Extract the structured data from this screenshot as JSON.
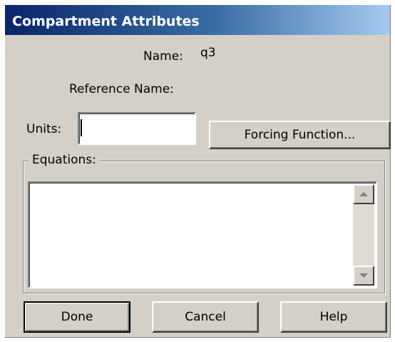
{
  "window": {
    "title": "Compartment Attributes"
  },
  "fields": {
    "name_label": "Name:",
    "name_value": "q3",
    "reference_name_label": "Reference Name:",
    "reference_name_value": "",
    "units_label": "Units:",
    "units_value": ""
  },
  "buttons": {
    "forcing_function": "Forcing Function...",
    "done": "Done",
    "cancel": "Cancel",
    "help": "Help"
  },
  "equations": {
    "label": "Equations:",
    "value": ""
  },
  "icons": {
    "scroll_up": "scroll-up-arrow-icon",
    "scroll_down": "scroll-down-arrow-icon"
  },
  "colors": {
    "dialog_face": "#d4d0c8",
    "titlebar_start": "#0a246a",
    "titlebar_end": "#a6caf0",
    "title_text": "#ffffff"
  }
}
